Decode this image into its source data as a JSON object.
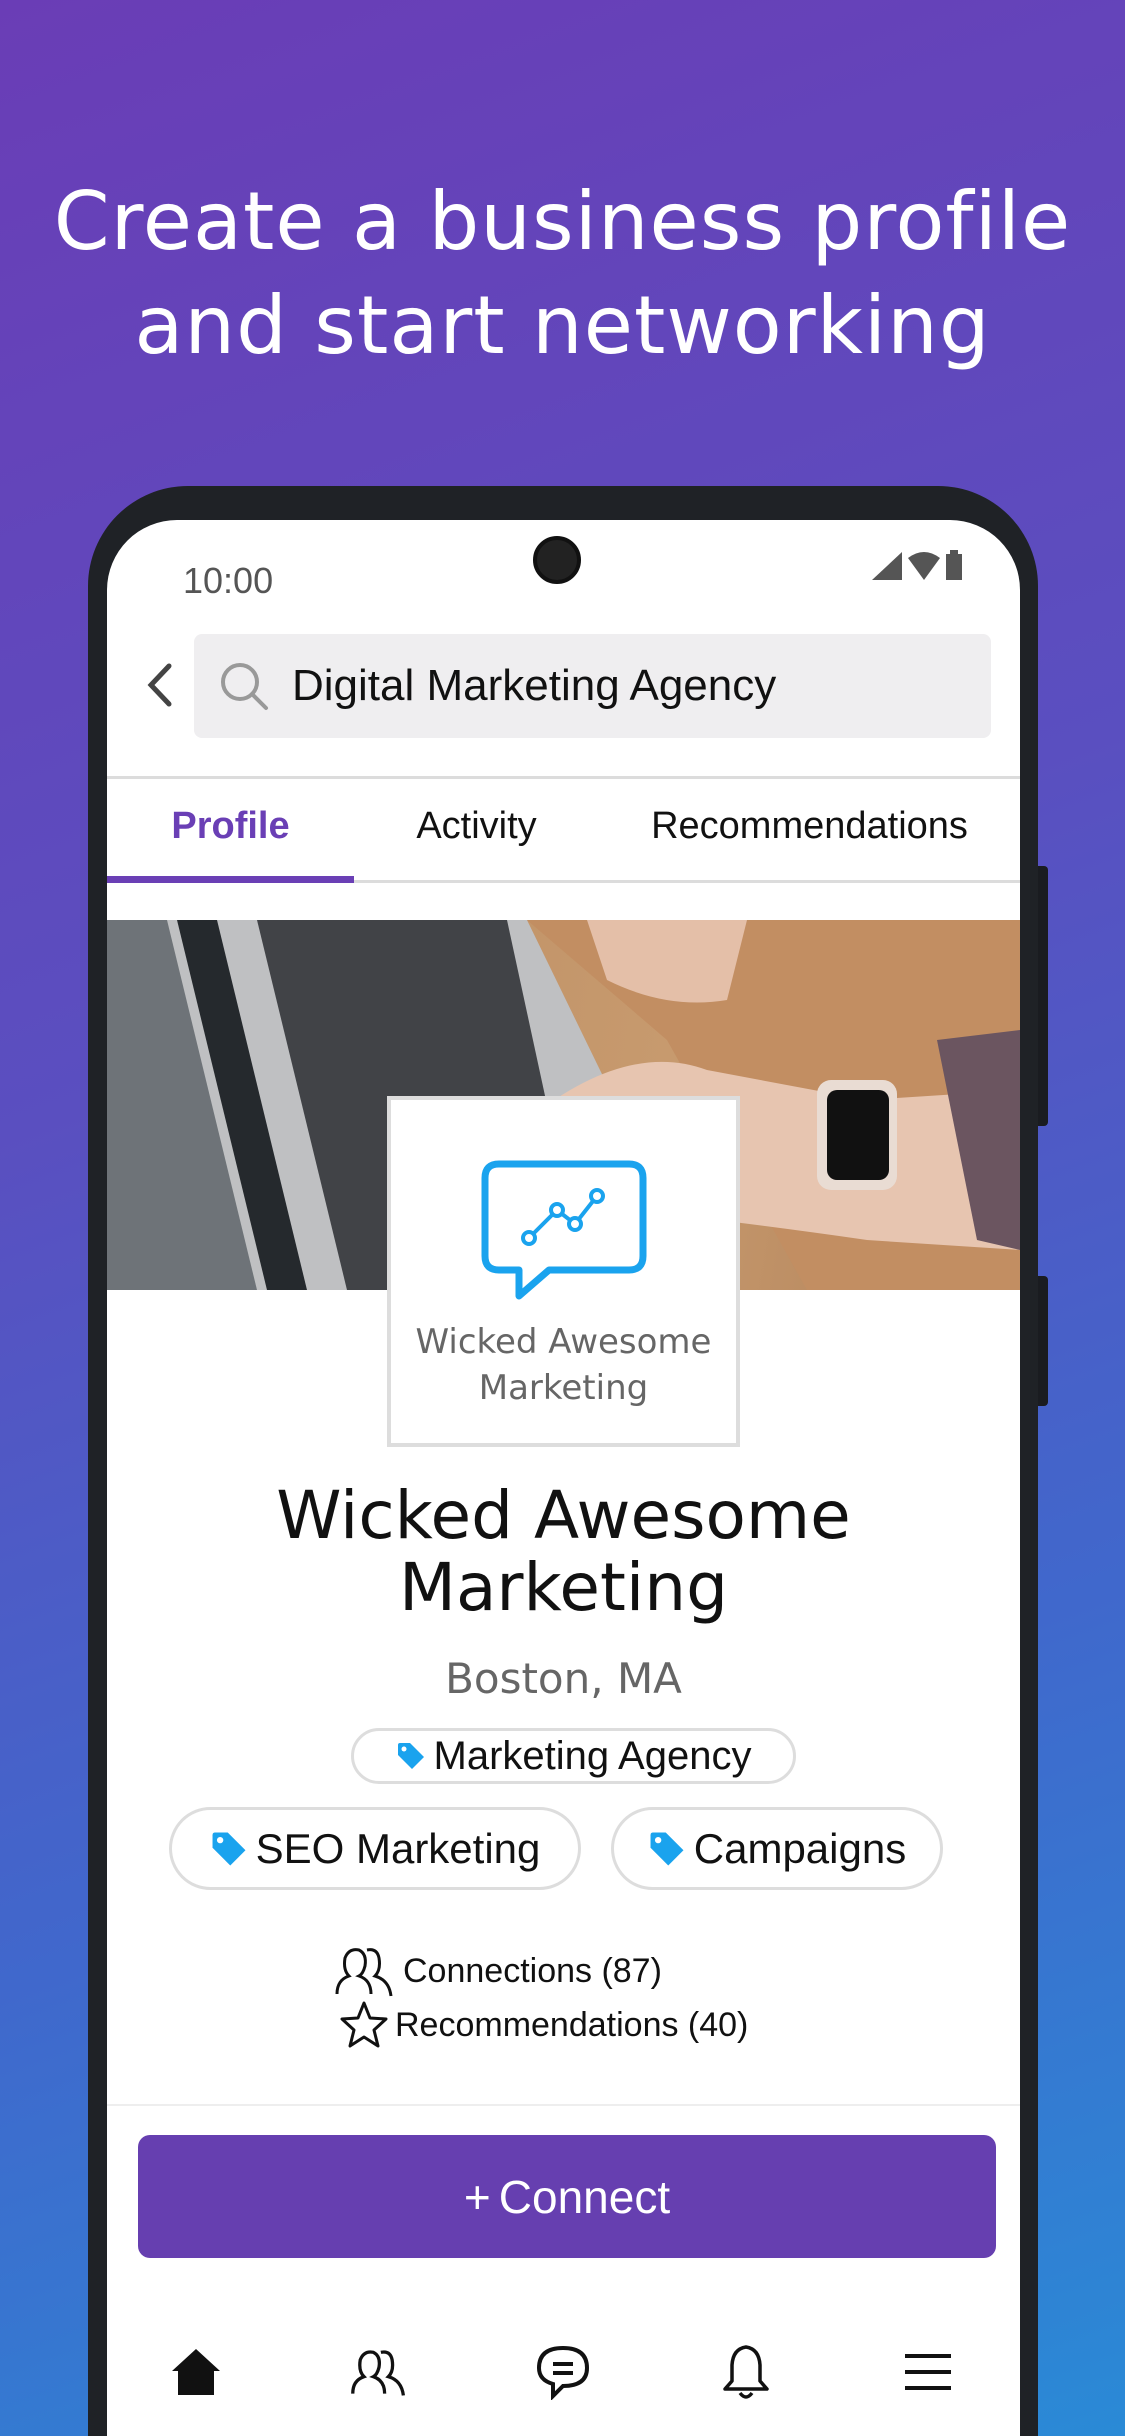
{
  "headline": {
    "line1": "Create a business profile",
    "line2": "and start networking"
  },
  "status_bar": {
    "time": "10:00"
  },
  "search": {
    "value": "Digital Marketing Agency"
  },
  "tabs": [
    {
      "label": "Profile",
      "active": true
    },
    {
      "label": "Activity"
    },
    {
      "label": "Recommendations"
    }
  ],
  "profile": {
    "logo_text_line1": "Wicked Awesome",
    "logo_text_line2": "Marketing",
    "name_line1": "Wicked Awesome",
    "name_line2": "Marketing",
    "location": "Boston, MA",
    "tags": [
      "Marketing Agency",
      "SEO Marketing",
      "Campaigns"
    ],
    "connections": "Connections (87)",
    "recommendations": "Recommendations (40)"
  },
  "connect_button": {
    "icon": "+",
    "label": "Connect"
  },
  "bottom_nav": [
    "home-icon",
    "people-icon",
    "chat-icon",
    "bell-icon",
    "menu-icon"
  ],
  "colors": {
    "accent": "#663fb0",
    "tag_icon": "#1aa3ee",
    "logo": "#1aa3ee"
  }
}
